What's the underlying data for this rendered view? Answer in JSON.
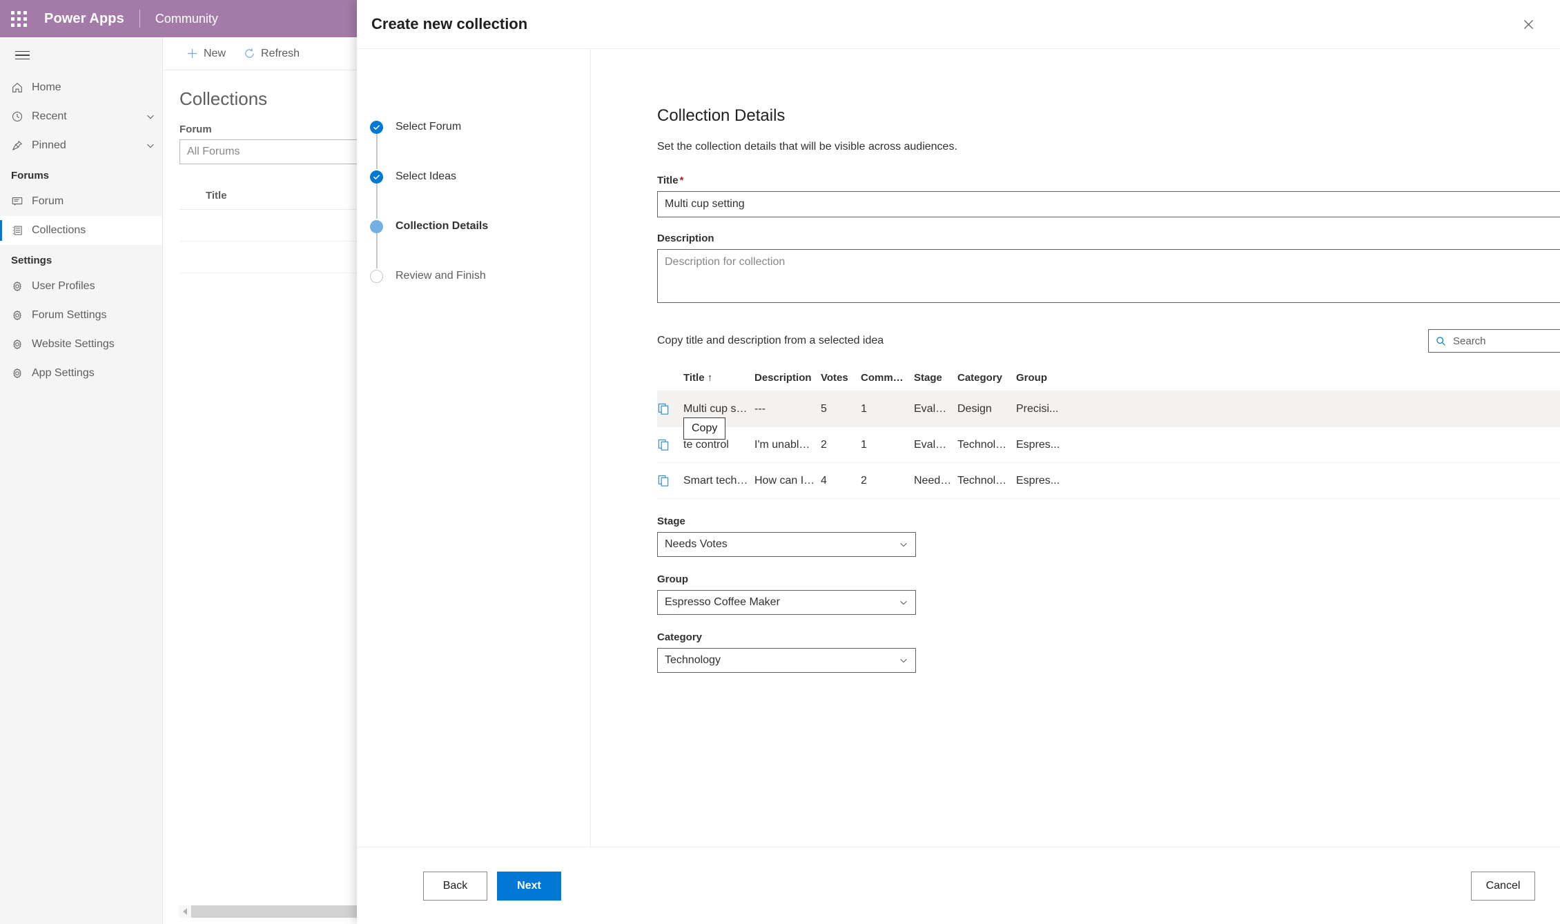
{
  "suite": {
    "waffle_icon": "app-launcher-icon",
    "brand": "Power Apps",
    "app_name": "Community",
    "header_color": "#a47ba8"
  },
  "sidebar": {
    "hamburger_icon": "hamburger-icon",
    "items": [
      {
        "label": "Home",
        "icon": "home-icon",
        "chevron": false,
        "selected": false
      },
      {
        "label": "Recent",
        "icon": "clock-icon",
        "chevron": true,
        "selected": false
      },
      {
        "label": "Pinned",
        "icon": "pin-icon",
        "chevron": true,
        "selected": false
      }
    ],
    "groups": [
      {
        "label": "Forums",
        "items": [
          {
            "label": "Forum",
            "icon": "forum-icon",
            "selected": false
          },
          {
            "label": "Collections",
            "icon": "list-icon",
            "selected": true
          }
        ]
      },
      {
        "label": "Settings",
        "items": [
          {
            "label": "User Profiles",
            "icon": "gear-icon",
            "selected": false
          },
          {
            "label": "Forum Settings",
            "icon": "gear-icon",
            "selected": false
          },
          {
            "label": "Website Settings",
            "icon": "gear-icon",
            "selected": false
          },
          {
            "label": "App Settings",
            "icon": "gear-icon",
            "selected": false
          }
        ]
      }
    ]
  },
  "commandbar": {
    "new_label": "New",
    "new_icon": "plus-icon",
    "refresh_label": "Refresh",
    "refresh_icon": "refresh-icon"
  },
  "page": {
    "title": "Collections",
    "forum_label": "Forum",
    "forum_value": "All Forums",
    "list_header_title": "Title"
  },
  "dialog": {
    "title": "Create new collection",
    "close_icon": "close-icon",
    "wizard": [
      {
        "label": "Select Forum",
        "state": "done"
      },
      {
        "label": "Select Ideas",
        "state": "done"
      },
      {
        "label": "Collection Details",
        "state": "current"
      },
      {
        "label": "Review and Finish",
        "state": "todo"
      }
    ],
    "section_title": "Collection Details",
    "section_subtitle": "Set the collection details that will be visible across audiences.",
    "fields": {
      "title_label": "Title",
      "title_required_mark": "*",
      "title_value": "Multi cup setting",
      "title_placeholder": "",
      "description_label": "Description",
      "description_value": "",
      "description_placeholder": "Description for collection"
    },
    "copy_section": {
      "label": "Copy title and description from a selected idea",
      "search_placeholder": "Search",
      "search_value": "",
      "search_icon": "search-icon",
      "tooltip": "Copy",
      "columns": [
        "",
        "Title",
        "Description",
        "Votes",
        "Comments",
        "Stage",
        "Category",
        "Group"
      ],
      "sort_column": "Title",
      "sort_indicator": "↑",
      "rows": [
        {
          "icon": "copy-icon",
          "title": "Multi cup setti...",
          "description": "---",
          "votes": "5",
          "comments": "1",
          "stage": "Evalua...",
          "category": "Design",
          "group": "Precisi...",
          "selected": true
        },
        {
          "icon": "copy-icon",
          "title": "te control",
          "description": "I'm unable to ...",
          "votes": "2",
          "comments": "1",
          "stage": "Evalua...",
          "category": "Technology",
          "group": "Espres...",
          "selected": false
        },
        {
          "icon": "copy-icon",
          "title": "Smart technol...",
          "description": "How can I bre...",
          "votes": "4",
          "comments": "2",
          "stage": "Needs...",
          "category": "Technology",
          "group": "Espres...",
          "selected": false
        }
      ]
    },
    "dropdowns": [
      {
        "label": "Stage",
        "value": "Needs Votes",
        "chevron_icon": "chevron-down-icon"
      },
      {
        "label": "Group",
        "value": "Espresso Coffee Maker",
        "chevron_icon": "chevron-down-icon"
      },
      {
        "label": "Category",
        "value": "Technology",
        "chevron_icon": "chevron-down-icon"
      }
    ],
    "footer": {
      "back_label": "Back",
      "next_label": "Next",
      "cancel_label": "Cancel",
      "primary_color": "#0078d4"
    }
  }
}
